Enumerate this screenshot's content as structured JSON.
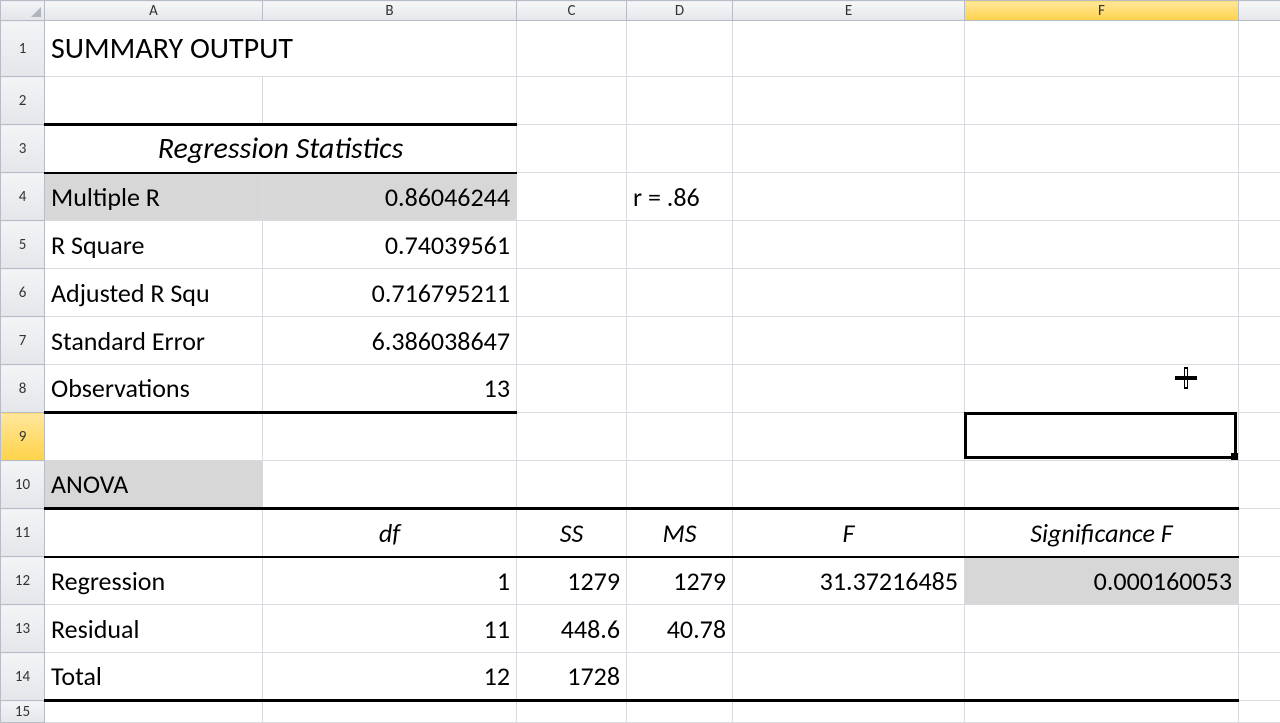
{
  "columns": [
    "A",
    "B",
    "C",
    "D",
    "E",
    "F"
  ],
  "rows": [
    "1",
    "2",
    "3",
    "4",
    "5",
    "6",
    "7",
    "8",
    "9",
    "10",
    "11",
    "12",
    "13",
    "14",
    "15"
  ],
  "selected": {
    "col": "F",
    "row": "9"
  },
  "cells": {
    "A1": "SUMMARY OUTPUT",
    "A3B3": "Regression Statistics",
    "A4": "Multiple R",
    "B4": "0.86046244",
    "D4": "r = .86",
    "A5": "R Square",
    "B5": "0.74039561",
    "A6": "Adjusted R Squ",
    "B6": "0.716795211",
    "A7": "Standard Error",
    "B7": "6.386038647",
    "A8": "Observations",
    "B8": "13",
    "A10": "ANOVA",
    "B11": "df",
    "C11": "SS",
    "D11": "MS",
    "E11": "F",
    "F11": "Significance F",
    "A12": "Regression",
    "B12": "1",
    "C12": "1279",
    "D12": "1279",
    "E12": "31.37216485",
    "F12": "0.000160053",
    "A13": "Residual",
    "B13": "11",
    "C13": "448.6",
    "D13": "40.78",
    "A14": "Total",
    "B14": "12",
    "C14": "1728"
  },
  "chart_data": {
    "type": "table",
    "title": "SUMMARY OUTPUT",
    "regression_statistics": {
      "Multiple R": 0.86046244,
      "R Square": 0.74039561,
      "Adjusted R Square": 0.716795211,
      "Standard Error": 6.386038647,
      "Observations": 13
    },
    "note": "r = .86",
    "anova": {
      "columns": [
        "",
        "df",
        "SS",
        "MS",
        "F",
        "Significance F"
      ],
      "rows": [
        {
          "label": "Regression",
          "df": 1,
          "SS": 1279,
          "MS": 1279,
          "F": 31.37216485,
          "SignificanceF": 0.000160053
        },
        {
          "label": "Residual",
          "df": 11,
          "SS": 448.6,
          "MS": 40.78,
          "F": null,
          "SignificanceF": null
        },
        {
          "label": "Total",
          "df": 12,
          "SS": 1728,
          "MS": null,
          "F": null,
          "SignificanceF": null
        }
      ]
    }
  }
}
